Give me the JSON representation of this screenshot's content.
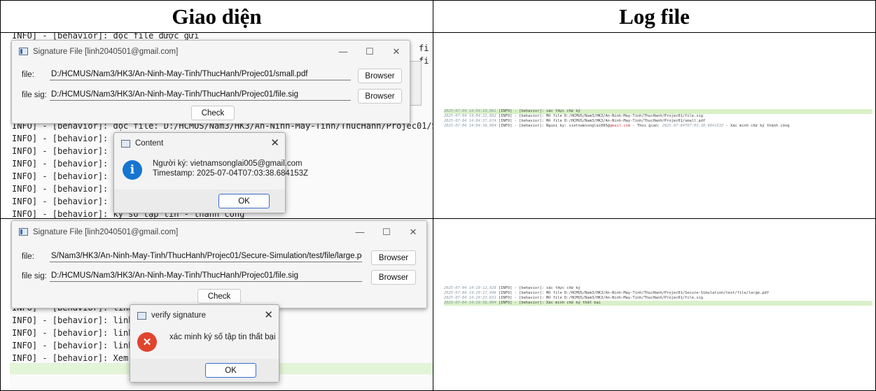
{
  "headers": {
    "left": "Giao diện",
    "right": "Log file"
  },
  "top": {
    "terminal_lines": [
      "INFO] - [behavior]: đọc file được gửi",
      "INFO] - [behavior]: đọc file: D:/HCMUS/Nam3/HK3/An-Ninh-May-Tinh/ThucHanh/Projec01/Secur",
      "INFO] - [behavior]: ký",
      "INFO] - [behavior]: đọ                                            -Tinh/ThucHanh/Projec01/Secur",
      "INFO] - [behavior]: ký",
      "INFO] - [behavior]: Lư                                            Tinh/ThucHanh/Projec01/file.si",
      "INFO] - [behavior]: Ký",
      "INFO] - [behavior]: đọ                                            -Tinh/ThucHanh/Projec01/Secur",
      "INFO] - [behavior]: ký số tập tin - thành công"
    ],
    "side_fragments": [
      "fi",
      "fi"
    ],
    "window": {
      "title": "Signature File [linh2040501@gmail.com]",
      "file_label": "file:",
      "file_value": "D:/HCMUS/Nam3/HK3/An-Ninh-May-Tinh/ThucHanh/Projec01/small.pdf",
      "sig_label": "file sig:",
      "sig_value": "D:/HCMUS/Nam3/HK3/An-Ninh-May-Tinh/ThucHanh/Projec01/file.sig",
      "browse_label": "Browser",
      "check_label": "Check"
    },
    "dialog": {
      "title": "Content",
      "line1": "Người ký: vietnamsonglai005@gmail.com",
      "line2": "Timestamp: 2025-07-04T07:03:38.684153Z",
      "ok": "OK"
    },
    "log_lines": [
      {
        "ts": "2025-07-04 14:04:10,061",
        "msg": "[INFO] - [behavior]: xác thực chữ ký"
      },
      {
        "ts": "2025-07-04 14:04:22,692",
        "msg": "[INFO] - [behavior]: Mở file D:/HCMUS/Nam3/HK3/An-Ninh-May-Tinh/ThucHanh/Projec01/file.sig"
      },
      {
        "ts": "2025-07-04 14:04:37,674",
        "msg": "[INFO] - [behavior]: Mở file D:/HCMUS/Nam3/HK3/An-Ninh-May-Tinh/ThucHanh/Projec01/small.pdf"
      },
      {
        "ts": "2025-07-04 14:04:39,804",
        "msg_a": "[INFO] - [behavior]: Nguoi ky: vietnamsonglai005@",
        "msg_b": "gmail.com",
        "msg_c": " - Thoi gian: ",
        "msg_d": "2025-07-04T07:03:38.684153Z",
        "msg_e": " - Xác minh chữ ký thành công"
      }
    ]
  },
  "bottom": {
    "terminal_lines": [
      "INFO] - [behavior]: linh                                                   count",
      "INFO] - [behavior]: linh                                                   unt",
      "INFO] - [behavior]: linh                                                   e thành admin",
      "INFO] - [behavior]: linh                                                   e thành user",
      "INFO] - [behavior]: Xem"
    ],
    "window": {
      "title": "Signature File [linh2040501@gmail.com]",
      "file_label": "file:",
      "file_value": "S/Nam3/HK3/An-Ninh-May-Tinh/ThucHanh/Projec01/Secure-Simulation/test/file/large.pdf",
      "sig_label": "file sig:",
      "sig_value": "D:/HCMUS/Nam3/HK3/An-Ninh-May-Tinh/ThucHanh/Projec01/file.sig",
      "browse_label": "Browser",
      "check_label": "Check"
    },
    "dialog": {
      "title": "verify signature",
      "line1": "xác minh ký số tập tin thất bại",
      "ok": "OK"
    },
    "log_lines": [
      {
        "ts": "2025-07-04 14:19:12,829",
        "msg": "[INFO] - [behavior]: xác thực chữ ký"
      },
      {
        "ts": "2025-07-04 14:19:17,946",
        "msg": "[INFO] - [behavior]: Mở file D:/HCMUS/Nam3/HK3/An-Ninh-May-Tinh/ThucHanh/Projec01/Secure-Simulation/test/file/large.pdf"
      },
      {
        "ts": "2025-07-04 14:19:23,631",
        "msg": "[INFO] - [behavior]: Mở file D:/HCMUS/Nam3/HK3/An-Ninh-May-Tinh/ThucHanh/Projec01/file.sig"
      },
      {
        "ts": "2025-07-04 14:19:58,904",
        "msg": "[INFO] - [behavior]: Xác minh chữ ký thất bại"
      }
    ]
  }
}
